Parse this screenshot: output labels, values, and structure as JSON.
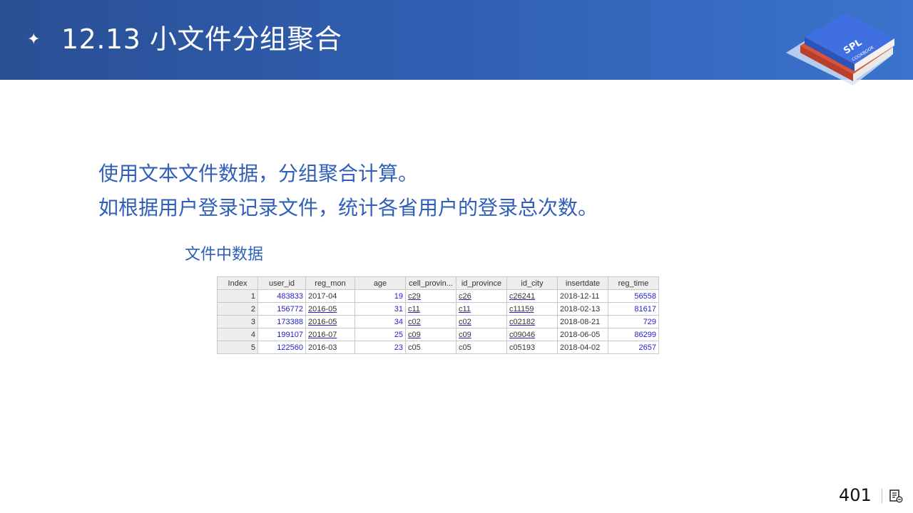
{
  "header": {
    "star": "✦",
    "title": "12.13 小文件分组聚合",
    "logo_text": "SPL",
    "logo_subtext": "COOKBOOK"
  },
  "intro": {
    "line1": "使用文本文件数据，分组聚合计算。",
    "line2": "如根据用户登录记录文件，统计各省用户的登录总次数。"
  },
  "caption": "文件中数据",
  "table": {
    "columns": [
      "Index",
      "user_id",
      "reg_mon",
      "age",
      "cell_provin...",
      "id_province",
      "id_city",
      "insertdate",
      "reg_time"
    ],
    "rows": [
      [
        "1",
        "483833",
        "2017-04",
        "19",
        "c29",
        "c26",
        "c26241",
        "2018-12-11",
        "56558"
      ],
      [
        "2",
        "156772",
        "2016-05",
        "31",
        "c11",
        "c11",
        "c11159",
        "2018-02-13",
        "81617"
      ],
      [
        "3",
        "173388",
        "2016-05",
        "34",
        "c02",
        "c02",
        "c02182",
        "2018-08-21",
        "729"
      ],
      [
        "4",
        "199107",
        "2016-07",
        "25",
        "c09",
        "c09",
        "c09046",
        "2018-06-05",
        "86299"
      ],
      [
        "5",
        "122560",
        "2016-03",
        "23",
        "c05",
        "c05",
        "c05193",
        "2018-04-02",
        "2657"
      ]
    ]
  },
  "footer": {
    "page_number": "401",
    "icon": "notes-icon"
  },
  "colors": {
    "header_start": "#2a4f94",
    "header_end": "#3b73cc",
    "accent_text": "#2f5fb8",
    "cell_number": "#2222cc"
  }
}
